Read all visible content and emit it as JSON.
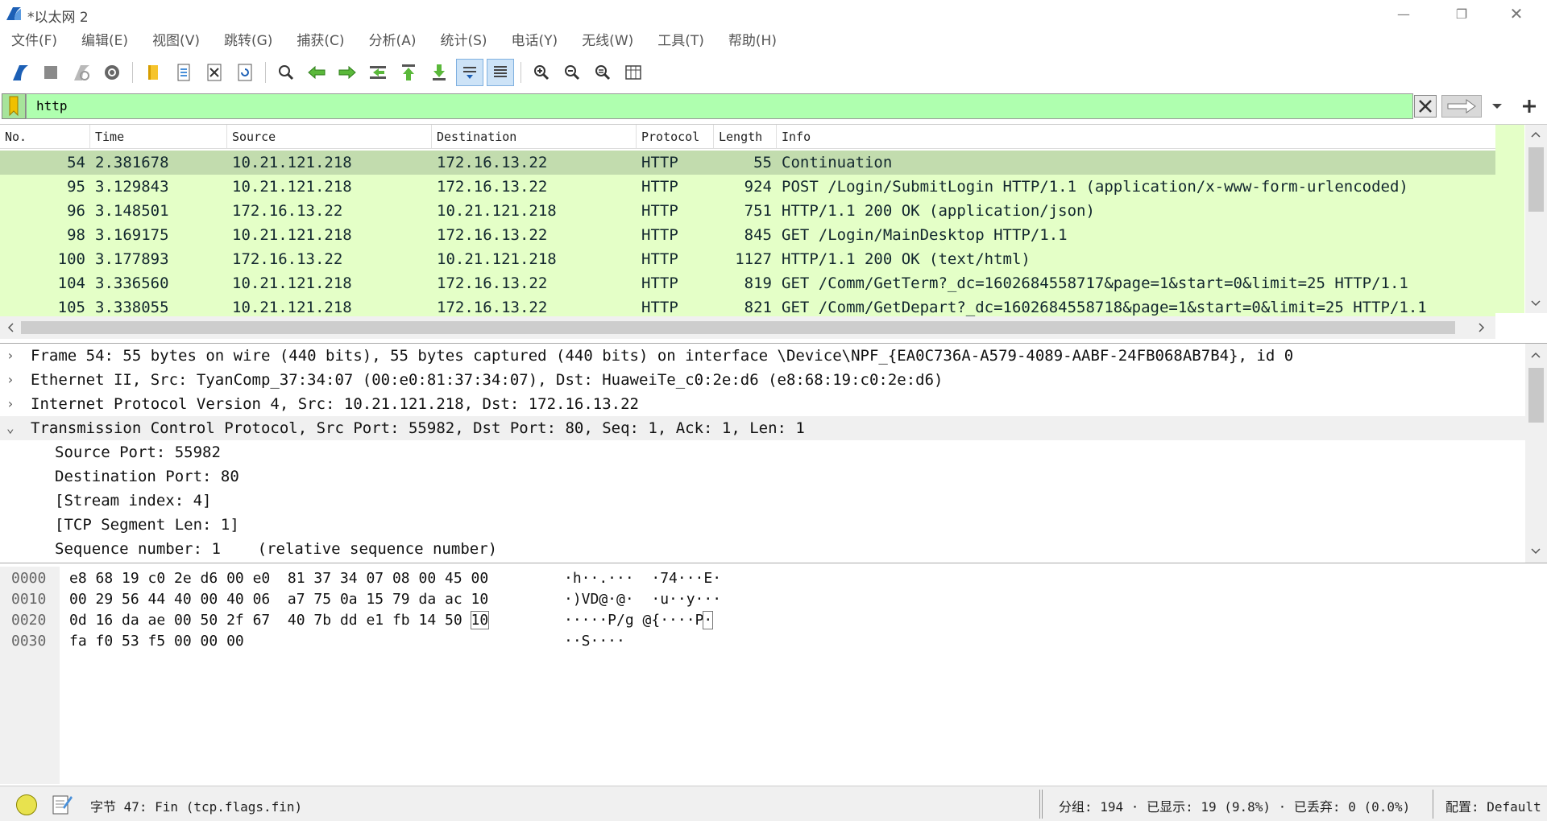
{
  "window": {
    "title": "*以太网 2",
    "minimize_glyph": "—",
    "restore_glyph": "❐",
    "close_glyph": "✕"
  },
  "menu": [
    "文件(F)",
    "编辑(E)",
    "视图(V)",
    "跳转(G)",
    "捕获(C)",
    "分析(A)",
    "统计(S)",
    "电话(Y)",
    "无线(W)",
    "工具(T)",
    "帮助(H)"
  ],
  "toolbar": {
    "icons": [
      "start-capture-icon",
      "stop-capture-icon",
      "restart-capture-icon",
      "capture-options-icon",
      "open-file-icon",
      "save-file-icon",
      "close-file-icon",
      "reload-file-icon",
      "find-packet-icon",
      "go-back-icon",
      "go-forward-icon",
      "go-to-packet-icon",
      "go-first-icon",
      "go-last-icon",
      "autoscroll-icon",
      "colorize-icon",
      "zoom-in-icon",
      "zoom-out-icon",
      "zoom-normal-icon",
      "resize-columns-icon"
    ]
  },
  "filter": {
    "value": "http",
    "bg_color": "#afffaf"
  },
  "packet_list": {
    "columns": [
      "No.",
      "Time",
      "Source",
      "Destination",
      "Protocol",
      "Length",
      "Info"
    ],
    "rows": [
      {
        "no": "54",
        "time": "2.381678",
        "source": "10.21.121.218",
        "destination": "172.16.13.22",
        "protocol": "HTTP",
        "length": "55",
        "info": "Continuation"
      },
      {
        "no": "95",
        "time": "3.129843",
        "source": "10.21.121.218",
        "destination": "172.16.13.22",
        "protocol": "HTTP",
        "length": "924",
        "info": "POST /Login/SubmitLogin HTTP/1.1  (application/x-www-form-urlencoded)"
      },
      {
        "no": "96",
        "time": "3.148501",
        "source": "172.16.13.22",
        "destination": "10.21.121.218",
        "protocol": "HTTP",
        "length": "751",
        "info": "HTTP/1.1 200 OK  (application/json)"
      },
      {
        "no": "98",
        "time": "3.169175",
        "source": "10.21.121.218",
        "destination": "172.16.13.22",
        "protocol": "HTTP",
        "length": "845",
        "info": "GET /Login/MainDesktop HTTP/1.1"
      },
      {
        "no": "100",
        "time": "3.177893",
        "source": "172.16.13.22",
        "destination": "10.21.121.218",
        "protocol": "HTTP",
        "length": "1127",
        "info": "HTTP/1.1 200 OK  (text/html)"
      },
      {
        "no": "104",
        "time": "3.336560",
        "source": "10.21.121.218",
        "destination": "172.16.13.22",
        "protocol": "HTTP",
        "length": "819",
        "info": "GET /Comm/GetTerm?_dc=1602684558717&page=1&start=0&limit=25 HTTP/1.1"
      },
      {
        "no": "105",
        "time": "3.338055",
        "source": "10.21.121.218",
        "destination": "172.16.13.22",
        "protocol": "HTTP",
        "length": "821",
        "info": "GET /Comm/GetDepart?_dc=1602684558718&page=1&start=0&limit=25 HTTP/1.1"
      }
    ],
    "row_color": "#e4ffc7",
    "selected_color": "#c2dcae"
  },
  "details": {
    "rows": [
      {
        "arrow": "›",
        "text": "Frame 54: 55 bytes on wire (440 bits), 55 bytes captured (440 bits) on interface \\Device\\NPF_{EA0C736A-A579-4089-AABF-24FB068AB7B4}, id 0"
      },
      {
        "arrow": "›",
        "text": "Ethernet II, Src: TyanComp_37:34:07 (00:e0:81:37:34:07), Dst: HuaweiTe_c0:2e:d6 (e8:68:19:c0:2e:d6)"
      },
      {
        "arrow": "›",
        "text": "Internet Protocol Version 4, Src: 10.21.121.218, Dst: 172.16.13.22"
      },
      {
        "arrow": "⌄",
        "text": "Transmission Control Protocol, Src Port: 55982, Dst Port: 80, Seq: 1, Ack: 1, Len: 1"
      }
    ],
    "children": [
      "Source Port: 55982",
      "Destination Port: 80",
      "[Stream index: 4]",
      "[TCP Segment Len: 1]",
      "Sequence number: 1    (relative sequence number)"
    ]
  },
  "bytes": {
    "rows": [
      {
        "offset": "0000",
        "hex": "e8 68 19 c0 2e d6 00 e0  81 37 34 07 08 00 45 00",
        "ascii": "·h··.···  ·74···E·"
      },
      {
        "offset": "0010",
        "hex": "00 29 56 44 40 00 40 06  a7 75 0a 15 79 da ac 10",
        "ascii": "·)VD@·@·  ·u··y···"
      },
      {
        "offset": "0020",
        "hex_main": "0d 16 da ae 00 50 2f 67  40 7b dd e1 fb 14 50 ",
        "hex_sel": "10",
        "ascii_main": "·····P/g @{····P",
        "ascii_sel": "·"
      },
      {
        "offset": "0030",
        "hex": "fa f0 53 f5 00 00 00",
        "ascii": "··S····"
      }
    ]
  },
  "status": {
    "field": "字节 47: Fin (tcp.flags.fin)",
    "packets": "分组: 194 · 已显示: 19 (9.8%) · 已丢弃: 0 (0.0%)",
    "profile": "配置: Default"
  }
}
